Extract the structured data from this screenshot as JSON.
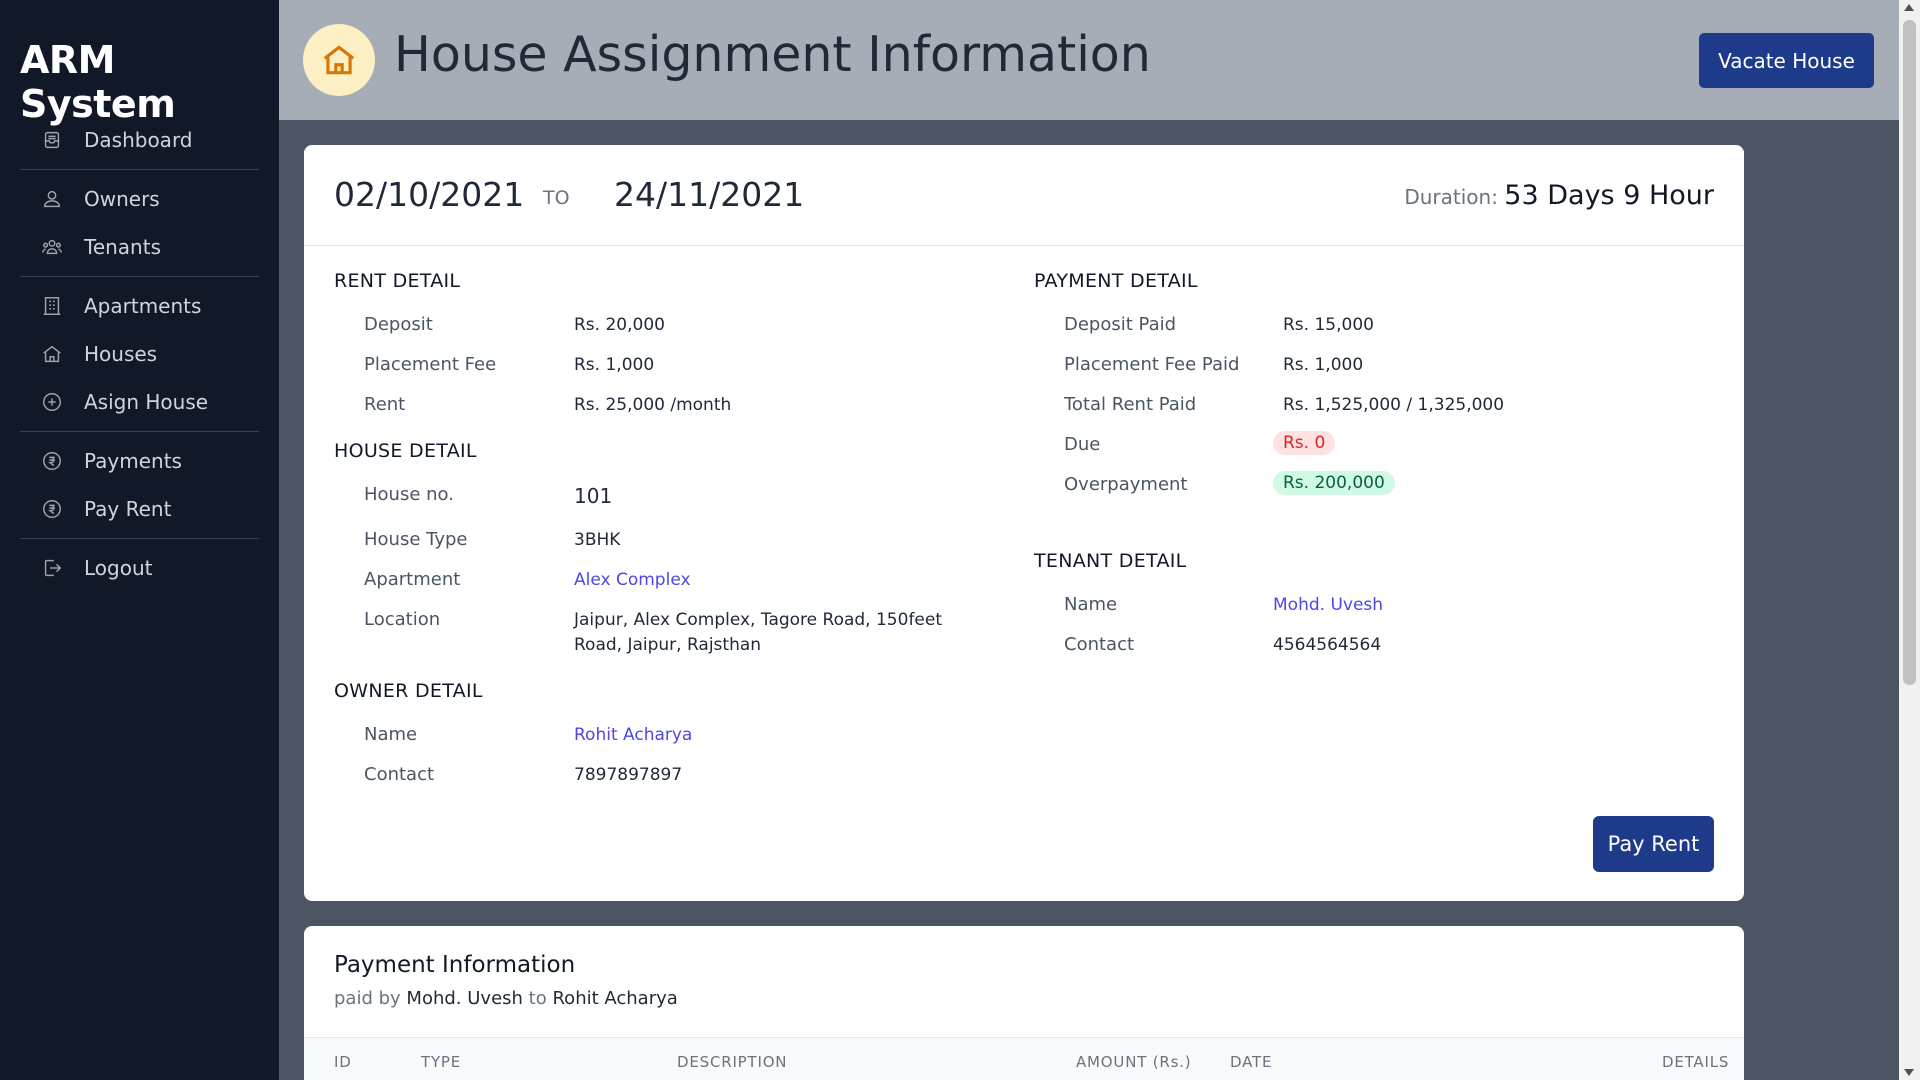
{
  "app": {
    "brand": "ARM System"
  },
  "sidebar": {
    "items": [
      {
        "label": "Dashboard",
        "icon": "inbox-icon"
      },
      {
        "label": "Owners",
        "icon": "users-icon"
      },
      {
        "label": "Tenants",
        "icon": "user-group-icon"
      },
      {
        "label": "Apartments",
        "icon": "building-icon"
      },
      {
        "label": "Houses",
        "icon": "home-icon"
      },
      {
        "label": "Asign House",
        "icon": "plus-circle-icon"
      },
      {
        "label": "Payments",
        "icon": "rupee-icon"
      },
      {
        "label": "Pay Rent",
        "icon": "rupee-icon"
      },
      {
        "label": "Logout",
        "icon": "logout-icon"
      }
    ]
  },
  "header": {
    "title": "House Assignment Information",
    "vacate_label": "Vacate House",
    "icon": "home-icon"
  },
  "assignment": {
    "from_date": "02/10/2021",
    "to_label": "TO",
    "to_date": "24/11/2021",
    "duration_label": "Duration:",
    "duration_value": "53 Days 9 Hour"
  },
  "rent_detail": {
    "title": "RENT DETAIL",
    "deposit_label": "Deposit",
    "deposit_value": "Rs. 20,000",
    "placement_label": "Placement Fee",
    "placement_value": "Rs. 1,000",
    "rent_label": "Rent",
    "rent_value": "Rs. 25,000 /month"
  },
  "house_detail": {
    "title": "HOUSE DETAIL",
    "no_label": "House no.",
    "no_value": "101",
    "type_label": "House Type",
    "type_value": "3BHK",
    "apartment_label": "Apartment",
    "apartment_value": "Alex Complex",
    "location_label": "Location",
    "location_line1": "Jaipur, Alex Complex, Tagore Road, 150feet",
    "location_line2": "Road, Jaipur, Rajsthan"
  },
  "owner_detail": {
    "title": "OWNER DETAIL",
    "name_label": "Name",
    "name_value": "Rohit Acharya",
    "contact_label": "Contact",
    "contact_value": "7897897897"
  },
  "payment_detail": {
    "title": "PAYMENT DETAIL",
    "deposit_paid_label": "Deposit Paid",
    "deposit_paid_value": "Rs. 15,000",
    "placement_paid_label": "Placement Fee Paid",
    "placement_paid_value": "Rs. 1,000",
    "total_rent_label": "Total Rent Paid",
    "total_rent_value": "Rs. 1,525,000 / 1,325,000",
    "due_label": "Due",
    "due_value": "Rs. 0",
    "overpayment_label": "Overpayment",
    "overpayment_value": "Rs. 200,000"
  },
  "tenant_detail": {
    "title": "TENANT DETAIL",
    "name_label": "Name",
    "name_value": "Mohd. Uvesh",
    "contact_label": "Contact",
    "contact_value": "4564564564"
  },
  "actions": {
    "pay_rent_label": "Pay Rent"
  },
  "payment_info": {
    "title": "Payment Information",
    "paid_by_label": "paid by",
    "payer": "Mohd. Uvesh",
    "to_label": "to",
    "payee": "Rohit Acharya",
    "columns": [
      "ID",
      "TYPE",
      "DESCRIPTION",
      "AMOUNT (Rs.)",
      "DATE",
      "DETAILS"
    ]
  },
  "colors": {
    "sidebar": "#111827",
    "header": "#a6adb7",
    "primary": "#1e3a8a",
    "link": "#4f46e5",
    "due_red": "#dc2626",
    "over_green": "#065f46"
  }
}
